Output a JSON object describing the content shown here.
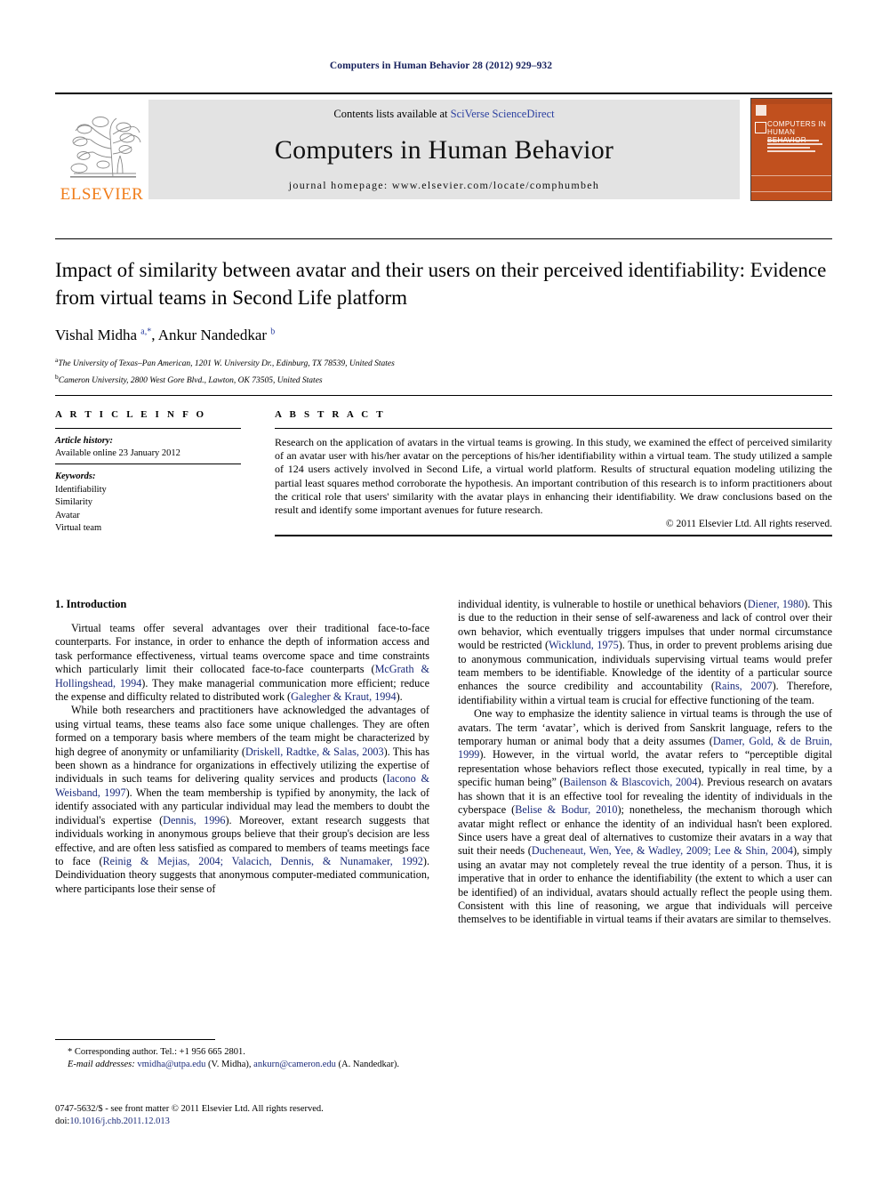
{
  "running_head": "Computers in Human Behavior 28 (2012) 929–932",
  "masthead": {
    "contents_prefix": "Contents lists available at ",
    "sciencedirect": "SciVerse ScienceDirect",
    "journal_title": "Computers in Human Behavior",
    "homepage": "journal homepage: www.elsevier.com/locate/comphumbeh",
    "publisher_wordmark": "ELSEVIER",
    "cover_title": "COMPUTERS IN HUMAN BEHAVIOR",
    "accent_orange": "#f07d1a",
    "cover_orange": "#c1501e",
    "link_blue": "#2b3fa0",
    "banner_grey": "#e3e3e3"
  },
  "article": {
    "title": "Impact of similarity between avatar and their users on their perceived identifiability: Evidence from virtual teams in Second Life platform",
    "authors_html": "Vishal Midha <sup>a,*</sup>, Ankur Nandedkar <sup>b</sup>",
    "affiliation_a": "The University of Texas–Pan American, 1201 W. University Dr., Edinburg, TX 78539, United States",
    "affiliation_b": "Cameron University, 2800 West Gore Blvd., Lawton, OK 73505, United States",
    "affiliation_a_marker": "a",
    "affiliation_b_marker": "b"
  },
  "info": {
    "heading": "A R T I C L E  I N F O",
    "history_label": "Article history:",
    "history_value": "Available online 23 January 2012",
    "keywords_label": "Keywords:",
    "keywords": [
      "Identifiability",
      "Similarity",
      "Avatar",
      "Virtual team"
    ]
  },
  "abstract": {
    "heading": "A B S T R A C T",
    "text": "Research on the application of avatars in the virtual teams is growing. In this study, we examined the effect of perceived similarity of an avatar user with his/her avatar on the perceptions of his/her identifiability within a virtual team. The study utilized a sample of 124 users actively involved in Second Life, a virtual world platform. Results of structural equation modeling utilizing the partial least squares method corroborate the hypothesis. An important contribution of this research is to inform practitioners about the critical role that users' similarity with the avatar plays in enhancing their identifiability. We draw conclusions based on the result and identify some important avenues for future research.",
    "copyright": "© 2011 Elsevier Ltd. All rights reserved."
  },
  "body": {
    "section_title": "1. Introduction",
    "left_paragraphs": [
      "Virtual teams offer several advantages over their traditional face-to-face counterparts. For instance, in order to enhance the depth of information access and task performance effectiveness, virtual teams overcome space and time constraints which particularly limit their collocated face-to-face counterparts (<span class=\"ref\">McGrath &amp; Hollingshead, 1994</span>). They make managerial communication more efficient; reduce the expense and difficulty related to distributed work (<span class=\"ref\">Galegher &amp; Kraut, 1994</span>).",
      "While both researchers and practitioners have acknowledged the advantages of using virtual teams, these teams also face some unique challenges. They are often formed on a temporary basis where members of the team might be characterized by high degree of anonymity or unfamiliarity (<span class=\"ref\">Driskell, Radtke, &amp; Salas, 2003</span>). This has been shown as a hindrance for organizations in effectively utilizing the expertise of individuals in such teams for delivering quality services and products (<span class=\"ref\">Iacono &amp; Weisband, 1997</span>). When the team membership is typified by anonymity, the lack of identify associated with any particular individual may lead the members to doubt the individual's expertise (<span class=\"ref\">Dennis, 1996</span>). Moreover, extant research suggests that individuals working in anonymous groups believe that their group's decision are less effective, and are often less satisfied as compared to members of teams meetings face to face (<span class=\"ref\">Reinig &amp; Mejias, 2004; Valacich, Dennis, &amp; Nunamaker, 1992</span>). Deindividuation theory suggests that anonymous computer-mediated communication, where participants lose their sense of"
    ],
    "right_paragraphs": [
      "individual identity, is vulnerable to hostile or unethical behaviors (<span class=\"ref\">Diener, 1980</span>). This is due to the reduction in their sense of self-awareness and lack of control over their own behavior, which eventually triggers impulses that under normal circumstance would be restricted (<span class=\"ref\">Wicklund, 1975</span>). Thus, in order to prevent problems arising due to anonymous communication, individuals supervising virtual teams would prefer team members to be identifiable. Knowledge of the identity of a particular source enhances the source credibility and accountability (<span class=\"ref\">Rains, 2007</span>). Therefore, identifiability within a virtual team is crucial for effective functioning of the team.",
      "One way to emphasize the identity salience in virtual teams is through the use of avatars. The term ‘avatar’, which is derived from Sanskrit language, refers to the temporary human or animal body that a deity assumes (<span class=\"ref\">Damer, Gold, &amp; de Bruin, 1999</span>). However, in the virtual world, the avatar refers to “perceptible digital representation whose behaviors reflect those executed, typically in real time, by a specific human being” (<span class=\"ref\">Bailenson &amp; Blascovich, 2004</span>). Previous research on avatars has shown that it is an effective tool for revealing the identity of individuals in the cyberspace (<span class=\"ref\">Belise &amp; Bodur, 2010</span>); nonetheless, the mechanism thorough which avatar might reflect or enhance the identity of an individual hasn't been explored. Since users have a great deal of alternatives to customize their avatars in a way that suit their needs (<span class=\"ref\">Ducheneaut, Wen, Yee, &amp; Wadley, 2009; Lee &amp; Shin, 2004</span>), simply using an avatar may not completely reveal the true identity of a person. Thus, it is imperative that in order to enhance the identifiability (the extent to which a user can be identified) of an individual, avatars should actually reflect the people using them. Consistent with this line of reasoning, we argue that individuals will perceive themselves to be identifiable in virtual teams if their avatars are similar to themselves."
    ]
  },
  "footnotes": {
    "corresponding": "* Corresponding author. Tel.: +1 956 665 2801.",
    "email_html": "<span class=\"em-lbl\">E-mail addresses:</span> <span class=\"mail\">vmidha@utpa.edu</span> (V. Midha), <span class=\"mail\">ankurn@cameron.edu</span> (A. Nandedkar)."
  },
  "footer": {
    "issn_line": "0747-5632/$ - see front matter © 2011 Elsevier Ltd. All rights reserved.",
    "doi_prefix": "doi:",
    "doi_value": "10.1016/j.chb.2011.12.013"
  }
}
